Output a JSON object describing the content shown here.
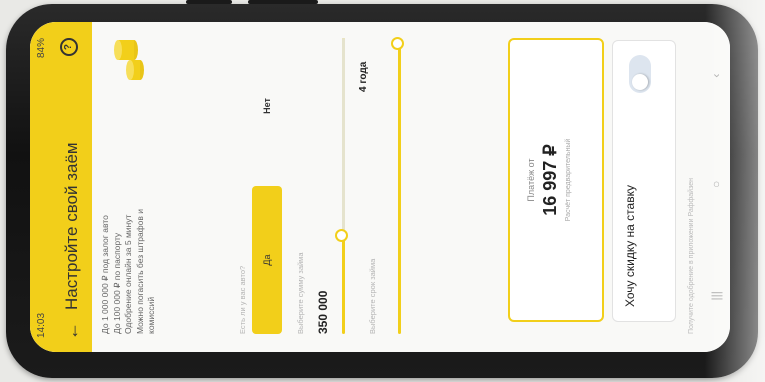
{
  "status": {
    "time": "14:03",
    "battery": "84%"
  },
  "header": {
    "title": "Настройте свой заём",
    "back_icon": "arrow-left-icon",
    "help_icon": "question-circle-icon"
  },
  "promo": {
    "lines": [
      "До 1 000 000 ₽ под залог авто",
      "До 100 000 ₽ по паспорту",
      "Одобрение онлайн за 5 минут",
      "Можно погасить без штрафов и",
      "комиссий"
    ]
  },
  "car_question": {
    "label": "Есть ли у вас авто?",
    "yes": "Да",
    "no": "Нет"
  },
  "amount": {
    "label": "Выберите сумму займа",
    "value": "350 000",
    "fraction": 0.33
  },
  "term": {
    "label": "Выберите срок займа",
    "value": "4 года",
    "fraction": 1.0
  },
  "payment": {
    "title": "Платёж от",
    "amount": "16 997 ₽",
    "note": "Расчёт предварительный"
  },
  "discount": {
    "label": "Хочу скидку на ставку",
    "sub": "",
    "enabled": false
  },
  "footnote": "Получите одобрение в приложении Раффайзен",
  "colors": {
    "accent": "#f2cf1a"
  }
}
